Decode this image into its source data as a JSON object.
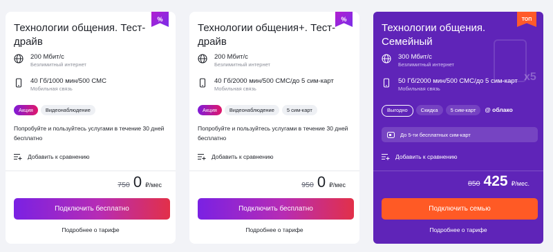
{
  "cards": [
    {
      "ribbon": "%",
      "title": "Технологии общения. Тест-драйв",
      "internet": {
        "main": "200 Мбит/с",
        "sub": "Безлимитный интернет"
      },
      "mobile": {
        "main": "40 Гб/1000 мин/500 СМС",
        "sub": "Мобильная связь"
      },
      "tags": [
        "Акция",
        "Видеонаблюдение"
      ],
      "description": "Попробуйте и пользуйтесь услугами в течение 30 дней бесплатно",
      "compare": "Добавить к сравнению",
      "price": {
        "old": "750",
        "new": "0",
        "unit": "₽/мес"
      },
      "button": "Подключить бесплатно",
      "more": "Подробнее о тарифе"
    },
    {
      "ribbon": "%",
      "title": "Технологии общения+. Тест-драйв",
      "internet": {
        "main": "200 Мбит/с",
        "sub": "Безлимитный интернет"
      },
      "mobile": {
        "main": "40 Гб/2000 мин/500 СМС/до 5 сим-карт",
        "sub": "Мобильная связь"
      },
      "tags": [
        "Акция",
        "Видеонаблюдение",
        "5 сим-карт"
      ],
      "description": "Попробуйте и пользуйтесь услугами в течение 30 дней бесплатно",
      "compare": "Добавить к сравнению",
      "price": {
        "old": "950",
        "new": "0",
        "unit": "₽/мес"
      },
      "button": "Подключить бесплатно",
      "more": "Подробнее о тарифе"
    },
    {
      "ribbon": "ТОП",
      "title": "Технологии общения. Семейный",
      "internet": {
        "main": "300 Мбит/с",
        "sub": "Безлимитный интернет"
      },
      "mobile": {
        "main": "50 Гб/2000 мин/500 СМС/до 5 сим-карт",
        "sub": "Мобильная связь"
      },
      "sim_badge": "x5",
      "tags": [
        "Выгодно",
        "Скидка",
        "5 сим-карт",
        "@ облако"
      ],
      "info": "До 5-ти бесплатных сим-карт",
      "compare": "Добавить к сравнению",
      "price": {
        "old": "850",
        "new": "425",
        "unit": "₽/мес."
      },
      "button": "Подключить семью",
      "more": "Подробнее о тарифе"
    }
  ],
  "colors": {
    "accent_purple": "#5f24b8",
    "button_orange": "#ff5a25",
    "gradient_start": "#7a21e3",
    "gradient_end": "#e23049"
  }
}
